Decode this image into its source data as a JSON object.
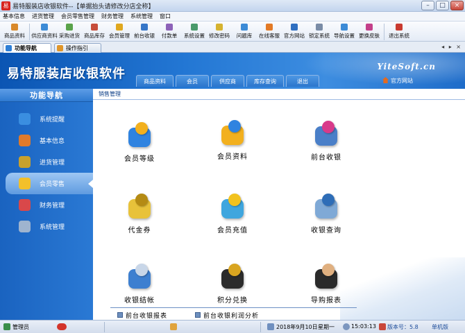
{
  "window": {
    "title": "易特服装店收银软件--【单据抬头请修改分店全称】",
    "app_icon_text": "易",
    "minimize": "–",
    "maximize": "□",
    "close": "×"
  },
  "menu": [
    "基本信息",
    "进货管理",
    "会员零售管理",
    "财务管理",
    "系统管理",
    "窗口"
  ],
  "toolbar": [
    {
      "label": "商品资料",
      "color": "#d9892a"
    },
    {
      "label": "供应商资料",
      "color": "#3c8bd6"
    },
    {
      "label": "采购进货",
      "color": "#5aa34a"
    },
    {
      "label": "商品库存",
      "color": "#c74d3a"
    },
    {
      "label": "会员管理",
      "color": "#e0a81f"
    },
    {
      "label": "前台收银",
      "color": "#3777c8"
    },
    {
      "label": "付款单",
      "color": "#8d62b8"
    },
    {
      "label": "系统设置",
      "color": "#4a9a6a"
    },
    {
      "label": "修改密码",
      "color": "#d6b330"
    },
    {
      "label": "问题库",
      "color": "#3c8bd6"
    },
    {
      "label": "在线客服",
      "color": "#e37a26"
    },
    {
      "label": "官方网站",
      "color": "#2f6fc0"
    },
    {
      "label": "锁定系统",
      "color": "#7a8ca6"
    },
    {
      "label": "导航设置",
      "color": "#3c8bd6"
    },
    {
      "label": "更换皮肤",
      "color": "#c4408a"
    },
    {
      "label": "退出系统",
      "color": "#c93b30"
    }
  ],
  "tabs": [
    {
      "label": "功能导航",
      "active": true
    },
    {
      "label": "操作指引",
      "active": false
    }
  ],
  "tab_nav": "◂ ▸ ×",
  "banner": {
    "brand": "易特服装店收银软件",
    "site": "YiteSoft.cn",
    "official_site": "官方网站",
    "quicknav": [
      "商品资料",
      "会员",
      "供应商",
      "库存查询",
      "退出"
    ]
  },
  "sidebar": {
    "title": "功能导航",
    "items": [
      {
        "label": "系统提醒",
        "color": "#3a8ee0",
        "active": false
      },
      {
        "label": "基本信息",
        "color": "#e07a2a",
        "active": false
      },
      {
        "label": "进货管理",
        "color": "#c9a12c",
        "active": false
      },
      {
        "label": "会员零售",
        "color": "#f2c02a",
        "active": true
      },
      {
        "label": "财务管理",
        "color": "#d9484a",
        "active": false
      },
      {
        "label": "系统管理",
        "color": "#9fb4cf",
        "active": false
      }
    ]
  },
  "content": {
    "breadcrumb": "销售管理",
    "functions": [
      {
        "label": "会员等级",
        "c1": "#2f83e0",
        "c2": "#f2b01e"
      },
      {
        "label": "会员资料",
        "c1": "#f2b01e",
        "c2": "#2f83e0"
      },
      {
        "label": "前台收银",
        "c1": "#4a7fc8",
        "c2": "#d83a8a"
      },
      {
        "label": "代金券",
        "c1": "#e8c23a",
        "c2": "#b58b14"
      },
      {
        "label": "会员充值",
        "c1": "#3fa6de",
        "c2": "#f2c21e"
      },
      {
        "label": "收银查询",
        "c1": "#7fa9d6",
        "c2": "#2e6db7"
      },
      {
        "label": "收银结帐",
        "c1": "#3d7fd0",
        "c2": "#c8d6e8"
      },
      {
        "label": "积分兑换",
        "c1": "#2b2b2b",
        "c2": "#d9a520"
      },
      {
        "label": "导购报表",
        "c1": "#2a2a2a",
        "c2": "#e0b080"
      }
    ],
    "reports": [
      "前台收银报表",
      "前台收银利润分析"
    ]
  },
  "statusbar": {
    "user": "管理员",
    "date": "2018年9月10日",
    "weekday": "星期一",
    "time": "15:03:13",
    "version": "版本号：5.8",
    "edition": "单机版"
  }
}
